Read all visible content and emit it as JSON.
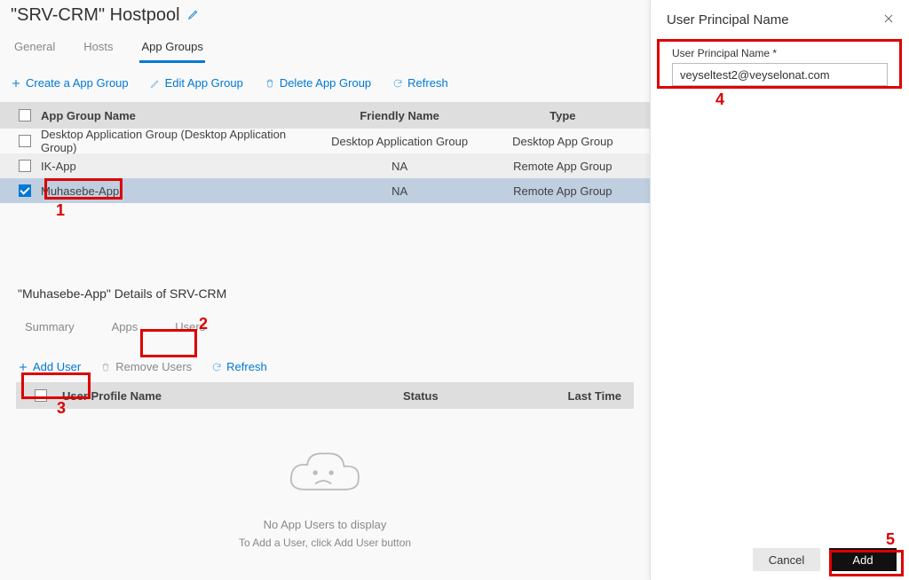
{
  "header": {
    "title": "\"SRV-CRM\" Hostpool"
  },
  "main_tabs": {
    "general": "General",
    "hosts": "Hosts",
    "app_groups": "App Groups"
  },
  "toolbar": {
    "create": "Create a App Group",
    "edit": "Edit App Group",
    "delete": "Delete App Group",
    "refresh": "Refresh"
  },
  "columns": {
    "name": "App Group Name",
    "friendly": "Friendly Name",
    "type": "Type"
  },
  "rows": [
    {
      "name": "Desktop Application Group (Desktop Application Group)",
      "friendly": "Desktop Application Group",
      "type": "Desktop App Group",
      "selected": false
    },
    {
      "name": "IK-App",
      "friendly": "NA",
      "type": "Remote App Group",
      "selected": false
    },
    {
      "name": "Muhasebe-App",
      "friendly": "NA",
      "type": "Remote App Group",
      "selected": true
    }
  ],
  "details": {
    "title": "\"Muhasebe-App\" Details of SRV-CRM",
    "tabs": {
      "summary": "Summary",
      "apps": "Apps",
      "users": "Users"
    },
    "toolbar": {
      "add": "Add User",
      "remove": "Remove Users",
      "refresh": "Refresh"
    },
    "columns": {
      "name": "User Profile Name",
      "status": "Status",
      "last": "Last Time"
    },
    "empty": {
      "line1": "No App Users to display",
      "line2": "To Add a User, click Add User button"
    }
  },
  "panel": {
    "title": "User Principal Name",
    "field_label": "User Principal Name *",
    "field_value": "veyseltest2@veyselonat.com",
    "cancel": "Cancel",
    "add": "Add"
  },
  "callouts": {
    "n1": "1",
    "n2": "2",
    "n3": "3",
    "n4": "4",
    "n5": "5"
  }
}
